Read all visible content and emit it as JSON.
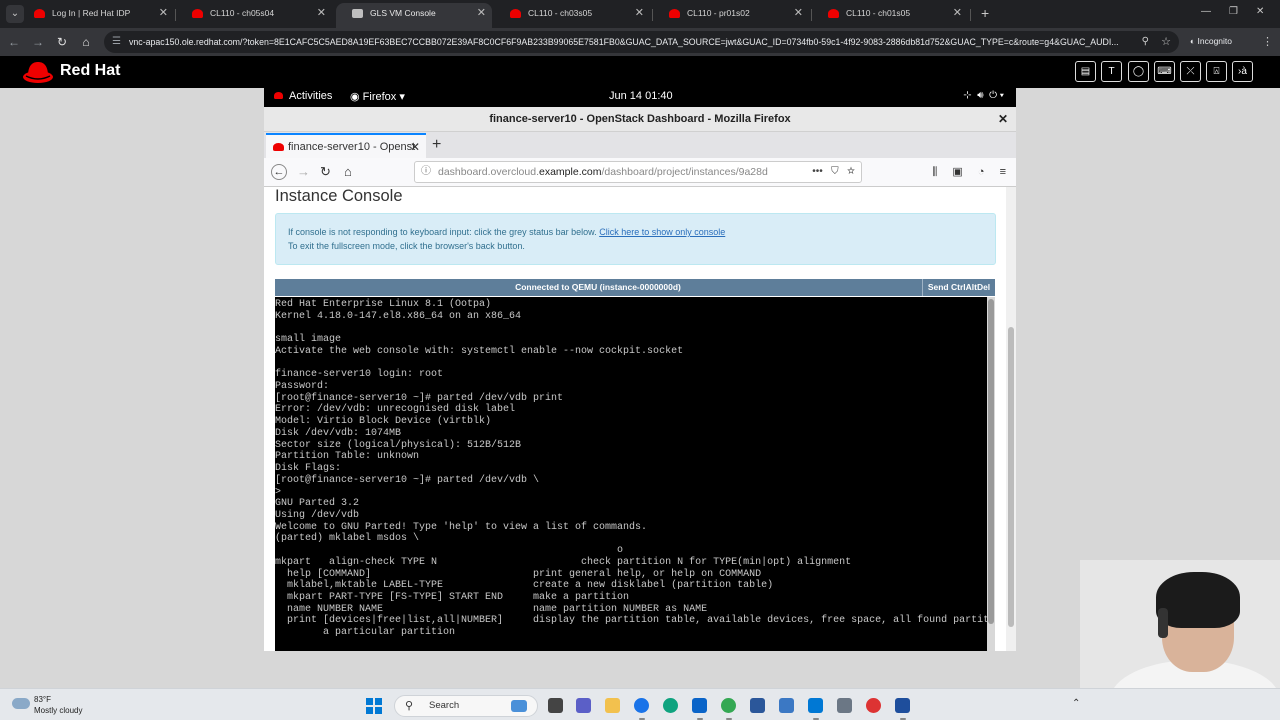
{
  "chrome": {
    "tabs": [
      {
        "label": "Log In | Red Hat IDP",
        "active": false
      },
      {
        "label": "CL110 - ch05s04",
        "active": false
      },
      {
        "label": "GLS VM Console",
        "active": true
      },
      {
        "label": "CL110 - ch03s05",
        "active": false
      },
      {
        "label": "CL110 - pr01s02",
        "active": false
      },
      {
        "label": "CL110 - ch01s05",
        "active": false
      }
    ],
    "url": "vnc-apac150.ole.redhat.com/?token=8E1CAFC5C5AED8A19EF63BEC7CCBB072E39AF8C0CF6F9AB233B99065E7581FB0&GUAC_DATA_SOURCE=jwt&GUAC_ID=0734fb0-59c1-4f92-9083-2886db81d752&GUAC_TYPE=c&route=g4&GUAC_AUDI...",
    "incognito_label": "Incognito"
  },
  "redhat": {
    "brand": "Red Hat",
    "brand_color": "#ee0000",
    "tools": [
      {
        "icon": "document-icon",
        "glyph": "▤"
      },
      {
        "icon": "text-icon",
        "glyph": "T"
      },
      {
        "icon": "refresh-icon",
        "glyph": "◯"
      },
      {
        "icon": "keyboard-icon",
        "glyph": "⌨"
      },
      {
        "icon": "disconnect-icon",
        "glyph": "⤫"
      },
      {
        "icon": "user-icon",
        "glyph": "⍓"
      },
      {
        "icon": "terminal-icon",
        "glyph": "›à"
      }
    ]
  },
  "gnome": {
    "activities": "Activities",
    "app": "Firefox",
    "clock": "Jun 14  01:40"
  },
  "firefox": {
    "window_title": "finance-server10 - OpenStack Dashboard - Mozilla Firefox",
    "tab_label": "finance-server10 - Openst",
    "url_prefix": "dashboard.overcloud.",
    "url_domain": "example.com",
    "url_path": "/dashboard/project/instances/9a28d",
    "url_menu": "•••"
  },
  "page": {
    "title": "Instance Console",
    "info_line1": "If console is not responding to keyboard input: click the grey status bar below.",
    "info_link": "Click here to show only console",
    "info_line2": "To exit the fullscreen mode, click the browser's back button.",
    "console_status": "Connected to QEMU (instance-0000000d)",
    "send_ctrl_alt_del": "Send CtrlAltDel"
  },
  "terminal": {
    "lines": [
      "Red Hat Enterprise Linux 8.1 (Ootpa)",
      "Kernel 4.18.0-147.el8.x86_64 on an x86_64",
      "",
      "small image",
      "Activate the web console with: systemctl enable --now cockpit.socket",
      "",
      "finance-server10 login: root",
      "Password:",
      "[root@finance-server10 ~]# parted /dev/vdb print",
      "Error: /dev/vdb: unrecognised disk label",
      "Model: Virtio Block Device (virtblk)",
      "Disk /dev/vdb: 1074MB",
      "Sector size (logical/physical): 512B/512B",
      "Partition Table: unknown",
      "Disk Flags:",
      "[root@finance-server10 ~]# parted /dev/vdb \\",
      ">",
      "GNU Parted 3.2",
      "Using /dev/vdb",
      "Welcome to GNU Parted! Type 'help' to view a list of commands.",
      "(parted) mklabel msdos \\",
      "                                                         o",
      "mkpart   align-check TYPE N                        check partition N for TYPE(min|opt) alignment",
      "  help [COMMAND]                           print general help, or help on COMMAND",
      "  mklabel,mktable LABEL-TYPE               create a new disklabel (partition table)",
      "  mkpart PART-TYPE [FS-TYPE] START END     make a partition",
      "  name NUMBER NAME                         name partition NUMBER as NAME",
      "  print [devices|free|list,all|NUMBER]     display the partition table, available devices, free space, all found partitio",
      "        a particular partition"
    ]
  },
  "taskbar": {
    "weather_temp": "83°F",
    "weather_desc": "Mostly cloudy",
    "search_label": "Search"
  }
}
